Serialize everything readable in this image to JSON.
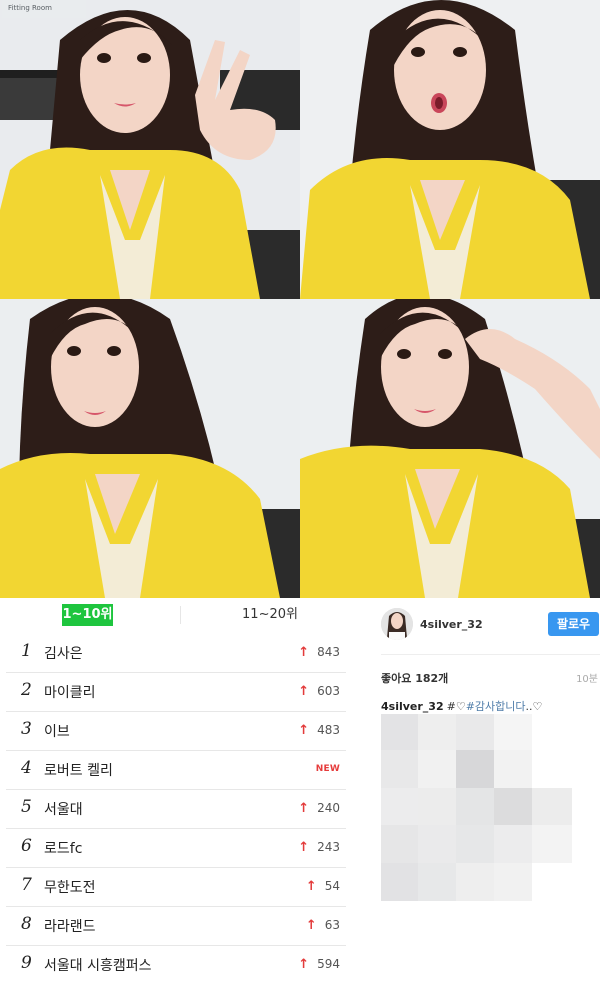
{
  "photo_grid": {
    "sign_text": "Fitting Room",
    "photos": [
      {
        "subject": "selfie-peace-sign"
      },
      {
        "subject": "selfie-surprised"
      },
      {
        "subject": "selfie-looking"
      },
      {
        "subject": "selfie-hand-on-head"
      }
    ],
    "colors": {
      "dress": "#f2d632",
      "hair": "#2d1d18",
      "skin": "#f3d5c6",
      "wall": "#eef0f2",
      "chair": "#2a2a2a"
    }
  },
  "ranking": {
    "tabs": [
      {
        "label": "1~10위",
        "active": true
      },
      {
        "label": "11~20위",
        "active": false
      }
    ],
    "rows": [
      {
        "rank": "1",
        "keyword": "김사은",
        "change": "843",
        "is_new": false
      },
      {
        "rank": "2",
        "keyword": "마이클리",
        "change": "603",
        "is_new": false
      },
      {
        "rank": "3",
        "keyword": "이브",
        "change": "483",
        "is_new": false
      },
      {
        "rank": "4",
        "keyword": "로버트 켈리",
        "change": "NEW",
        "is_new": true
      },
      {
        "rank": "5",
        "keyword": "서울대",
        "change": "240",
        "is_new": false
      },
      {
        "rank": "6",
        "keyword": "로드fc",
        "change": "243",
        "is_new": false
      },
      {
        "rank": "7",
        "keyword": "무한도전",
        "change": "54",
        "is_new": false
      },
      {
        "rank": "8",
        "keyword": "라라랜드",
        "change": "63",
        "is_new": false
      },
      {
        "rank": "9",
        "keyword": "서울대 시흥캠퍼스",
        "change": "594",
        "is_new": false
      }
    ],
    "arrow_glyph": "↑",
    "colors": {
      "tab_active": "#1ec53e",
      "up_arrow": "#e33b3b",
      "new": "#e63c3c"
    }
  },
  "instagram": {
    "username": "4silver_32",
    "follow_label": "팔로우",
    "likes_label": "좋아요 182개",
    "time_label": "10분",
    "caption_user": "4silver_32",
    "caption_prefix": "#♡",
    "caption_hashtag": "#감사합니다",
    "caption_suffix": "..♡",
    "colors": {
      "follow": "#3897f0",
      "hashtag": "#4d7ba8"
    }
  }
}
